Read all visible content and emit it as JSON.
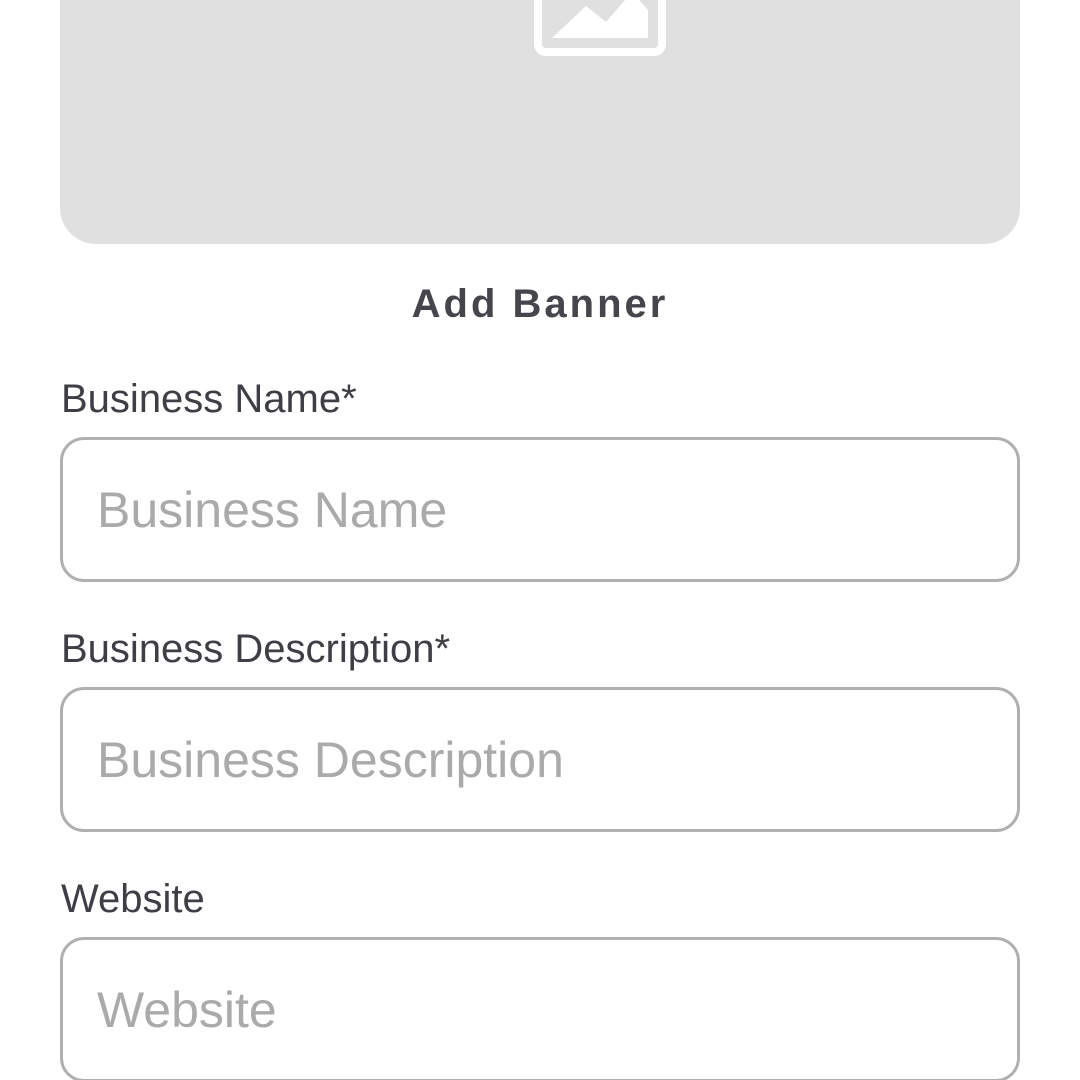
{
  "banner": {
    "icon": "image-placeholder-icon",
    "add_label": "Add Banner",
    "background_color": "#e0e0e0"
  },
  "form": {
    "business_name": {
      "label": "Business Name*",
      "placeholder": "Business Name",
      "value": ""
    },
    "business_description": {
      "label": "Business Description*",
      "placeholder": "Business Description",
      "value": ""
    },
    "website": {
      "label": "Website",
      "placeholder": "Website",
      "value": ""
    }
  }
}
